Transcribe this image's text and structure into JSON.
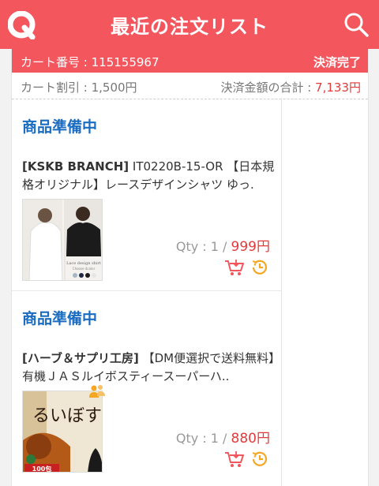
{
  "header": {
    "title": "最近の注文リスト",
    "accent_color": "#f4565d"
  },
  "cart": {
    "number_label": "カート番号",
    "number_value": "115155967",
    "status": "決済完了",
    "discount_label": "カート割引",
    "discount_value": "1,500円",
    "total_label": "決済金額の合計",
    "total_value": "7,133円"
  },
  "orders": [
    {
      "status": "商品準備中",
      "shop": "[KSKB BRANCH]",
      "name": " IT0220B-15-OR 【日本規格オリジナル】レースデザインシャツ ゆっ.",
      "qty_label": "Qty : 1 /",
      "price": "999円",
      "thumb_text": "Lace design shirt",
      "thumb_subtext": "Choose 4color",
      "icons": [
        "cart-icon",
        "history-clock-icon"
      ]
    },
    {
      "status": "商品準備中",
      "shop": "[ハーブ＆サプリ工房]",
      "name": " 【DM便選択で送料無料】有機ＪＡＳルイボスティースーパーハ..",
      "qty_label": "Qty : 1 /",
      "price": "880円",
      "thumb_text": "るいぼす",
      "thumb_subtext": "100包",
      "icons": [
        "people-icon",
        "cart-icon",
        "history-clock-icon"
      ]
    }
  ]
}
